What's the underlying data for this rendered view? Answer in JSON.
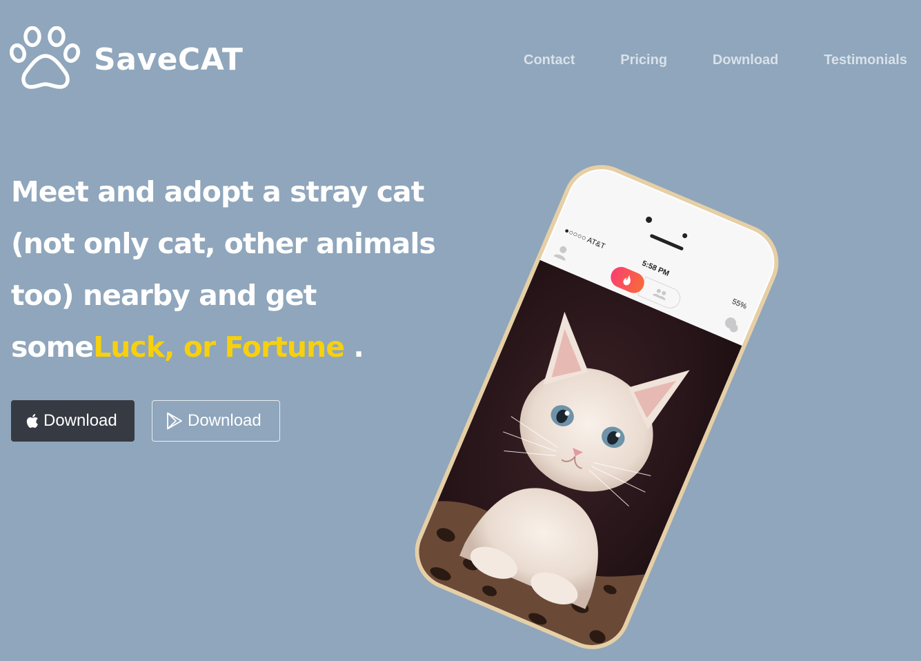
{
  "brand": {
    "name": "SaveCAT",
    "icon": "paw-icon"
  },
  "nav": {
    "items": [
      {
        "label": "Contact"
      },
      {
        "label": "Pricing"
      },
      {
        "label": "Download"
      },
      {
        "label": "Testimonials"
      }
    ]
  },
  "hero": {
    "headline_main": "Meet and adopt a stray cat (not only cat, other animals too) nearby and get some",
    "headline_accent": "Luck, or Fortune",
    "headline_end": " .",
    "accent_color": "#f7d00e",
    "background_color": "#8fa6bc"
  },
  "buttons": {
    "ios": {
      "label": "Download",
      "icon": "apple-icon"
    },
    "android": {
      "label": "Download",
      "icon": "google-play-icon"
    }
  },
  "phone": {
    "carrier": "●○○○○ AT&T",
    "time": "5:58 PM",
    "battery": "55%"
  }
}
